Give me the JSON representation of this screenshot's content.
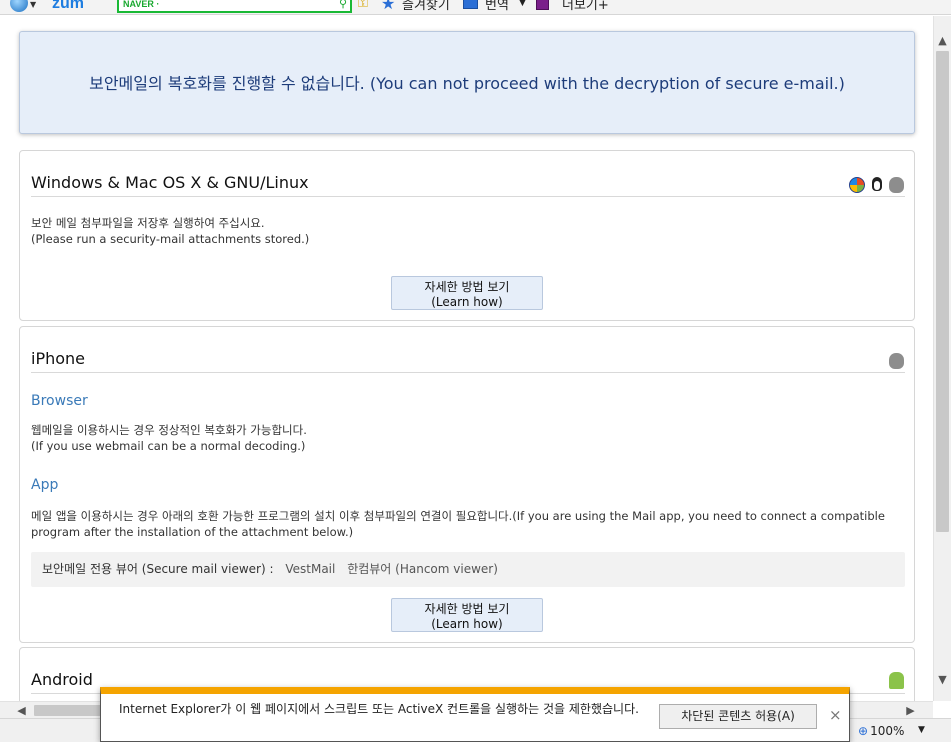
{
  "toolbar": {
    "ie_icon": "ie-logo-icon",
    "zum_label": "zum",
    "naver_label": "NAVER ·",
    "favorites_label": "즐겨찾기",
    "translate_label": "번역",
    "more_label": "더보기+"
  },
  "alert": {
    "message": "보안메일의 복호화를 진행할 수 없습니다. (You can not proceed with the decryption of secure e-mail.)"
  },
  "sections": {
    "desktop": {
      "title": "Windows & Mac OS X & GNU/Linux",
      "text_ko": "보안 메일 첨부파일을 저장후 실행하여 주십시요.",
      "text_en": "(Please run a security-mail attachments stored.)",
      "button_ko": "자세한 방법 보기",
      "button_en": "(Learn how)"
    },
    "iphone": {
      "title": "iPhone",
      "browser_title": "Browser",
      "browser_text_ko": "웹메일을 이용하시는 경우 정상적인 복호화가 가능합니다.",
      "browser_text_en": "(If you use webmail can be a normal decoding.)",
      "app_title": "App",
      "app_text": "메일 앱을 이용하시는 경우 아래의 호환 가능한 프로그램의 설치 이후 첨부파일의 연결이 필요합니다.(If you are using the Mail app, you need to connect a compatible program after the installation of the attachment below.)",
      "viewer_label": "보안메일 전용 뷰어 (Secure mail viewer) :",
      "viewer_link_1": "VestMail",
      "viewer_link_2": "한컴뷰어 (Hancom viewer)",
      "button_ko": "자세한 방법 보기",
      "button_en": "(Learn how)"
    },
    "android": {
      "title": "Android"
    }
  },
  "notification": {
    "message": "Internet Explorer가 이 웹 페이지에서 스크립트 또는 ActiveX 컨트롤을 실행하는 것을 제한했습니다.",
    "allow_button": "차단된 콘텐츠 허용(A)",
    "close_symbol": "×"
  },
  "statusbar": {
    "zoom": "100%"
  },
  "colors": {
    "alert_bg": "#e6eef9",
    "alert_text": "#1d3c7a",
    "subheading": "#3a7ab8",
    "notify_accent": "#f5a400"
  }
}
